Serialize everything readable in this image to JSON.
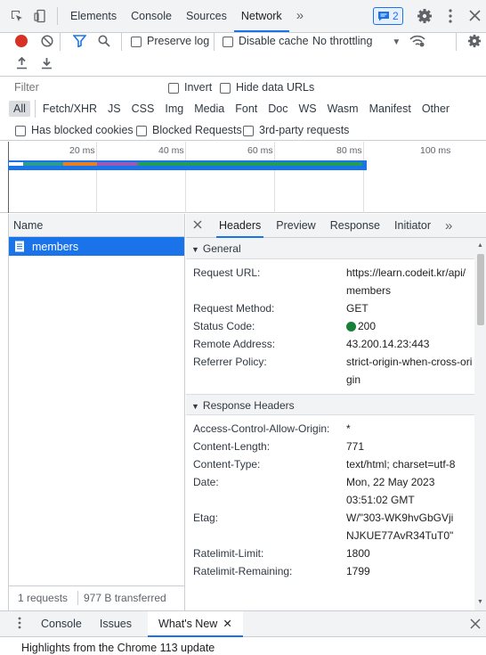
{
  "toptabs": [
    "Elements",
    "Console",
    "Sources",
    "Network"
  ],
  "active_tab": "Network",
  "more_tabs": "»",
  "issues_count": "2",
  "toolbar": {
    "preserve_log": "Preserve log",
    "disable_cache": "Disable cache",
    "throttling": "No throttling"
  },
  "filter": {
    "placeholder": "Filter",
    "invert": "Invert",
    "hide_data_urls": "Hide data URLs"
  },
  "types": [
    "All",
    "Fetch/XHR",
    "JS",
    "CSS",
    "Img",
    "Media",
    "Font",
    "Doc",
    "WS",
    "Wasm",
    "Manifest",
    "Other"
  ],
  "blocked": {
    "cookies": "Has blocked cookies",
    "requests": "Blocked Requests",
    "third_party": "3rd-party requests"
  },
  "timeline": {
    "ticks": [
      "20 ms",
      "40 ms",
      "60 ms",
      "80 ms",
      "100 ms"
    ]
  },
  "list": {
    "header": "Name",
    "items": [
      "members"
    ],
    "status": "1 requests",
    "transferred": "977 B transferred"
  },
  "detail": {
    "tabs": [
      "Headers",
      "Preview",
      "Response",
      "Initiator"
    ],
    "more": "»",
    "general": {
      "title": "General",
      "rows": [
        {
          "k": "Request URL:",
          "v": "https://learn.codeit.kr/api/members"
        },
        {
          "k": "Request Method:",
          "v": "GET"
        },
        {
          "k": "Status Code:",
          "v": "200"
        },
        {
          "k": "Remote Address:",
          "v": "43.200.14.23:443"
        },
        {
          "k": "Referrer Policy:",
          "v": "strict-origin-when-cross-origin"
        }
      ]
    },
    "response": {
      "title": "Response Headers",
      "rows": [
        {
          "k": "Access-Control-Allow-Origin:",
          "v": "*"
        },
        {
          "k": "Content-Length:",
          "v": "771"
        },
        {
          "k": "Content-Type:",
          "v": "text/html; charset=utf-8"
        },
        {
          "k": "Date:",
          "v": "Mon, 22 May 2023 03:51:02 GMT"
        },
        {
          "k": "Etag:",
          "v": "W/\"303-WK9hvGbGVjiNJKUE77AvR34TuT0\""
        },
        {
          "k": "Ratelimit-Limit:",
          "v": "1800"
        },
        {
          "k": "Ratelimit-Remaining:",
          "v": "1799"
        }
      ]
    }
  },
  "drawer": {
    "tabs": [
      "Console",
      "Issues",
      "What's New"
    ],
    "content": "Highlights from the Chrome 113 update"
  },
  "colors": {
    "accent": "#1a73e8",
    "record": "#d93025",
    "status_ok": "#188038"
  }
}
